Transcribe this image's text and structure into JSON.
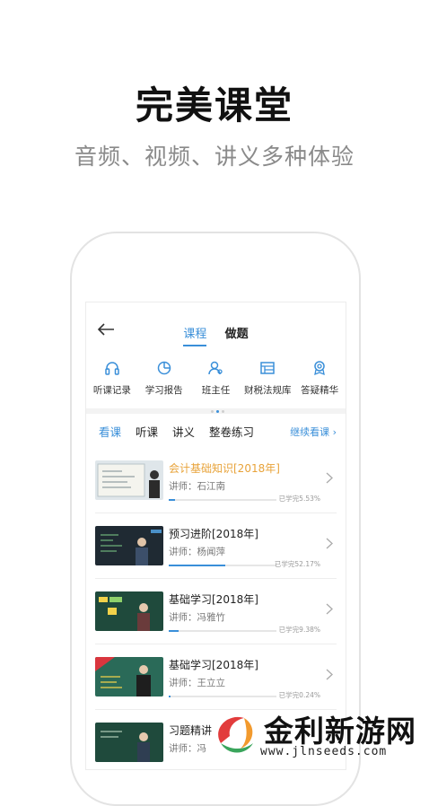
{
  "headline": "完美课堂",
  "subheadline": "音频、视频、讲义多种体验",
  "nav": {
    "tabs": [
      {
        "label": "课程",
        "active": true
      },
      {
        "label": "做题",
        "active": false
      }
    ]
  },
  "quick_actions": [
    {
      "label": "听课记录",
      "icon": "headphones-icon"
    },
    {
      "label": "学习报告",
      "icon": "report-icon"
    },
    {
      "label": "班主任",
      "icon": "teacher-icon"
    },
    {
      "label": "财税法规库",
      "icon": "law-library-icon"
    },
    {
      "label": "答疑精华",
      "icon": "qa-badge-icon"
    }
  ],
  "pager": {
    "active_index": 1,
    "count": 3
  },
  "sub_tabs": [
    "看课",
    "听课",
    "讲义",
    "整卷练习"
  ],
  "continue_label": "继续看课",
  "courses": [
    {
      "title": "会计基础知识[2018年]",
      "teacher": "讲师：石江南",
      "progress_text": "已学完5.53%",
      "progress": 0.0553,
      "highlight": true
    },
    {
      "title": "预习进阶[2018年]",
      "teacher": "讲师：杨闻萍",
      "progress_text": "已学完52.17%",
      "progress": 0.5217,
      "highlight": false
    },
    {
      "title": "基础学习[2018年]",
      "teacher": "讲师：冯雅竹",
      "progress_text": "已学完9.38%",
      "progress": 0.0938,
      "highlight": false
    },
    {
      "title": "基础学习[2018年]",
      "teacher": "讲师：王立立",
      "progress_text": "已学完0.24%",
      "progress": 0.0024,
      "highlight": false
    },
    {
      "title": "习题精讲",
      "teacher": "讲师：冯",
      "progress_text": "",
      "progress": 0,
      "highlight": false
    }
  ],
  "watermark": {
    "title": "金利新游网",
    "url": "www.jlnseeds.com"
  },
  "colors": {
    "accent": "#3a8fd9",
    "highlight": "#e8a33a"
  }
}
